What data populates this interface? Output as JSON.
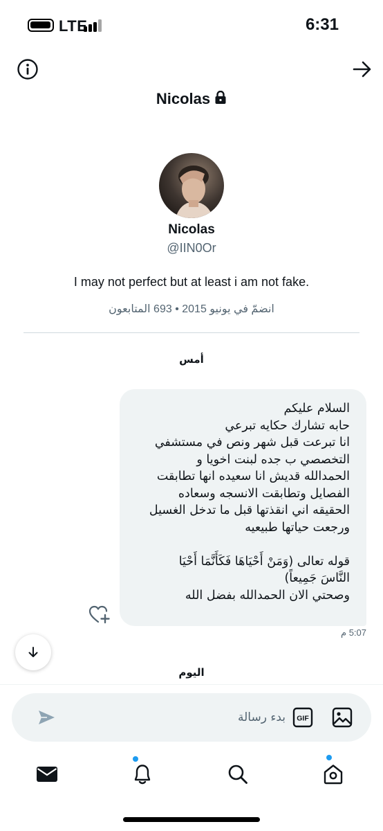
{
  "status_bar": {
    "network": "LTE",
    "time": "6:31"
  },
  "header": {
    "title": "Nicolas",
    "icons": {
      "info": "info-icon",
      "back": "arrow-right-icon",
      "lock": "lock-icon"
    }
  },
  "profile": {
    "name": "Nicolas",
    "handle": "@IIN0Or",
    "bio": "I may not perfect but at least i am not fake.",
    "meta": "انضمّ في يونيو 2015 • 693 المتابعون"
  },
  "conversation": {
    "yesterday_label": "أمس",
    "today_label": "اليوم",
    "message": {
      "text": "السلام عليكم\nحابه تشارك حكايه تبرعي\nانا تبرعت قبل شهر ونص في مستشفي\nالتخصصي ب جده لبنت اخويا و\nالحمدالله قديش انا سعيده انها تطابقت\nالفصايل وتطابقت الانسجه وسعاده\nالحقيقه اني انقذتها قبل ما تدخل الغسيل\nورجعت حياتها طبيعيه\n\nقوله تعالى (وَمَنْ أَحْيَاهَا فَكَأَنَّمَا أَحْيَا\nالنَّاسَ جَمِيعاً)\nوصحتي الان الحمدالله بفضل الله",
      "time": "5:07 م"
    }
  },
  "composer": {
    "placeholder": "بدء رسالة",
    "gif_label": "GIF"
  },
  "tabs": [
    {
      "name": "mail",
      "icon": "mail-icon",
      "badge": false
    },
    {
      "name": "notifications",
      "icon": "bell-icon",
      "badge": true
    },
    {
      "name": "search",
      "icon": "search-icon",
      "badge": false
    },
    {
      "name": "home",
      "icon": "home-icon",
      "badge": true
    }
  ],
  "colors": {
    "accent": "#1d9bf0",
    "bubble": "#eff3f4",
    "secondary_text": "#536471",
    "primary_text": "#0f1419"
  }
}
